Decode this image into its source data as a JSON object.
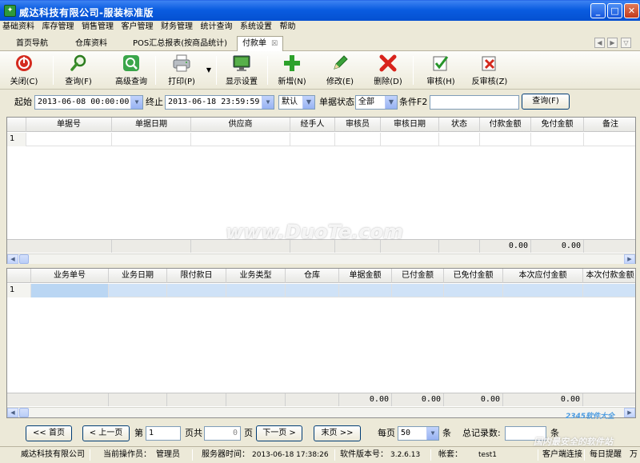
{
  "window": {
    "title": "威达科技有限公司-服装标准版",
    "app_icon": "app-logo-icon",
    "controls": {
      "minimize": "_",
      "maximize": "□",
      "close": "✕"
    }
  },
  "menu": [
    "基础资料",
    "库存管理",
    "销售管理",
    "客户管理",
    "财务管理",
    "统计查询",
    "系统设置",
    "帮助"
  ],
  "tabs": {
    "items": [
      "首页导航",
      "仓库资料",
      "POS汇总报表(按商品统计)",
      "付款单"
    ],
    "active": "付款单",
    "close_glyph": "☒"
  },
  "toolbar": {
    "close": "关闭(C)",
    "query": "查询(F)",
    "advanced_query": "高级查询",
    "print": "打印(P)",
    "display_settings": "显示设置",
    "add": "新增(N)",
    "modify": "修改(E)",
    "delete": "删除(D)",
    "approve": "审核(H)",
    "unapprove": "反审核(Z)"
  },
  "filter": {
    "start_label": "起始",
    "start_value": "2013-06-08 00:00:00",
    "end_label": "终止",
    "end_value": "2013-06-18 23:59:59",
    "sort_value": "默认",
    "status_label": "单据状态",
    "status_value": "全部",
    "condition_label": "条件F2",
    "condition_value": "",
    "query_button": "查询(F)"
  },
  "upper_grid": {
    "columns": [
      "单据号",
      "单据日期",
      "供应商",
      "经手人",
      "审核员",
      "审核日期",
      "状态",
      "付款金额",
      "免付金额",
      "备注"
    ],
    "rows": [
      {
        "no": "1"
      }
    ],
    "footer": {
      "pay_amount": "0.00",
      "free_amount": "0.00"
    }
  },
  "lower_grid": {
    "columns": [
      "业务单号",
      "业务日期",
      "限付款日",
      "业务类型",
      "仓库",
      "单据金额",
      "已付金额",
      "已免付金额",
      "本次应付金额",
      "本次付款金额"
    ],
    "rows": [
      {
        "no": "1"
      }
    ],
    "footer": {
      "doc_amount": "0.00",
      "paid_amount": "0.00",
      "free_paid_amount": "0.00",
      "due_amount": "0.00"
    }
  },
  "pager": {
    "first": "<< 首页",
    "prev": "< 上一页",
    "page_label": "第",
    "page_value": "1",
    "total_pages_label": "页共",
    "total_pages_value": "0",
    "page_suffix": "页",
    "next": "下一页 >",
    "last": "末页 >>",
    "per_page_label": "每页",
    "per_page_value": "50",
    "per_page_suffix": "条",
    "total_records_label": "总记录数:",
    "total_records_value": "",
    "total_records_suffix": "条"
  },
  "statusbar": {
    "company": "威达科技有限公司",
    "operator_label": "当前操作员：",
    "operator": "管理员",
    "server_time_label": "服务器时间：",
    "server_time": "2013-06-18 17:38:26",
    "version_label": "软件版本号：",
    "version": "3.2.6.13",
    "account_label": "帐套：",
    "account": "test1",
    "client_status": "客户端连接",
    "daily_reminder": "每日提醒",
    "extra": "万"
  },
  "watermarks": {
    "main": "www.DuoTe.com",
    "corner_brand": "2345软件大全",
    "corner_slogan": "国内最安全的软件站"
  }
}
